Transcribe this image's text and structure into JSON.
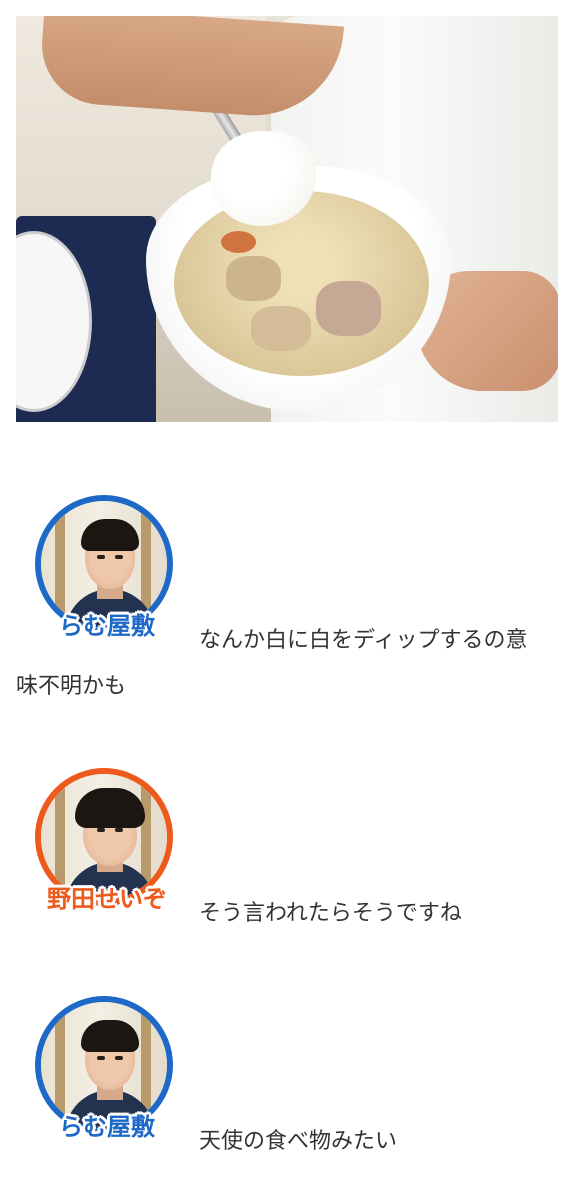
{
  "photo": {
    "alt_subject": "bowl-of-cream-stew-with-rice"
  },
  "messages": [
    {
      "speaker": "らむ屋敷",
      "text": "なんか白に白をディップするの意味不明かも",
      "ring_color": "#1e69c8"
    },
    {
      "speaker": "野田せいぞ",
      "text": "そう言われたらそうですね",
      "ring_color": "#ee5a1c"
    },
    {
      "speaker": "らむ屋敷",
      "text": "天使の食べ物みたい",
      "ring_color": "#1e69c8"
    }
  ],
  "colors": {
    "background": "#ffffff",
    "text": "#333333",
    "blue_accent": "#1e69c8",
    "orange_accent": "#ee5a1c"
  }
}
